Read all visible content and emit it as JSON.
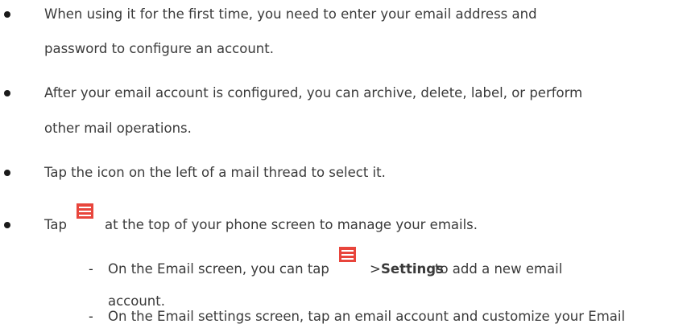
{
  "bullets": [
    {
      "line1": "When using it for the first time, you need to enter your email address and",
      "line2": "password to configure an account."
    },
    {
      "line1": "After your email account is configured, you can archive, delete, label, or perform",
      "line2": "other mail operations."
    },
    {
      "line1": "Tap the icon on the left of a mail thread to select it."
    },
    {
      "prefix": "Tap",
      "icon": "menu-icon",
      "suffix": "at the top of your phone screen to manage your emails."
    }
  ],
  "sub_items": [
    {
      "dash": "-",
      "prefix": "On the Email screen, you can tap",
      "icon": "menu-icon",
      "arrow": ">",
      "bold": "Settings",
      "suffix": "to add a new email",
      "line2": "account."
    },
    {
      "dash": "-",
      "line1": "On the Email settings screen, tap an email account and customize your Email"
    }
  ],
  "colors": {
    "icon_accent": "#e8453c",
    "text": "#3a3a3a"
  }
}
